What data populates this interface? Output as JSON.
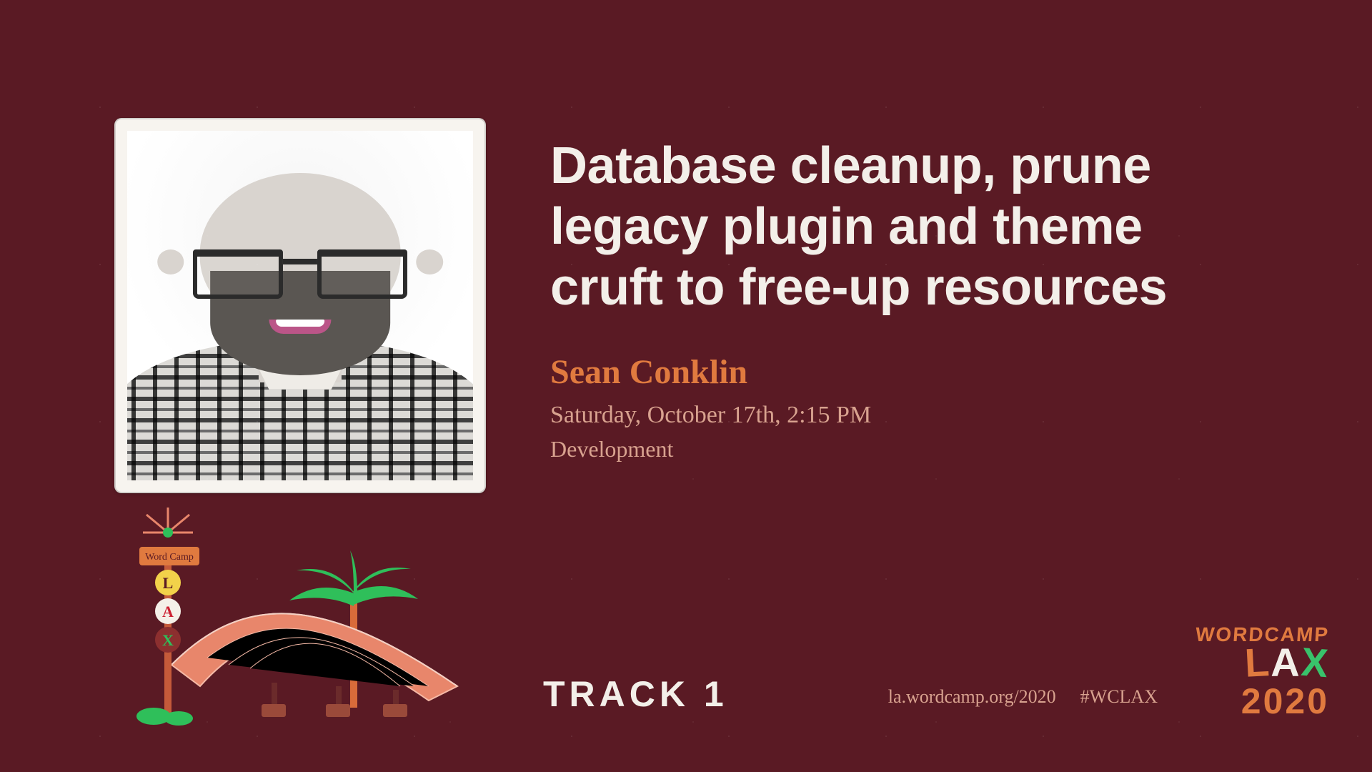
{
  "talk": {
    "title": "Database cleanup, prune legacy plugin and theme cruft to free-up resources",
    "speaker": "Sean Conklin",
    "datetime": "Saturday, October 17th, 2:15 PM",
    "category": "Development"
  },
  "footer": {
    "track": "TRACK 1",
    "site": "la.wordcamp.org/2020",
    "hashtag": "#WCLAX"
  },
  "brand": {
    "top": "WORDCAMP",
    "mid_L": "L",
    "mid_A": "A",
    "mid_X": "X",
    "year": "2020"
  },
  "motel_sign": {
    "line": "Word Camp",
    "letters": [
      "L",
      "A",
      "X"
    ]
  }
}
